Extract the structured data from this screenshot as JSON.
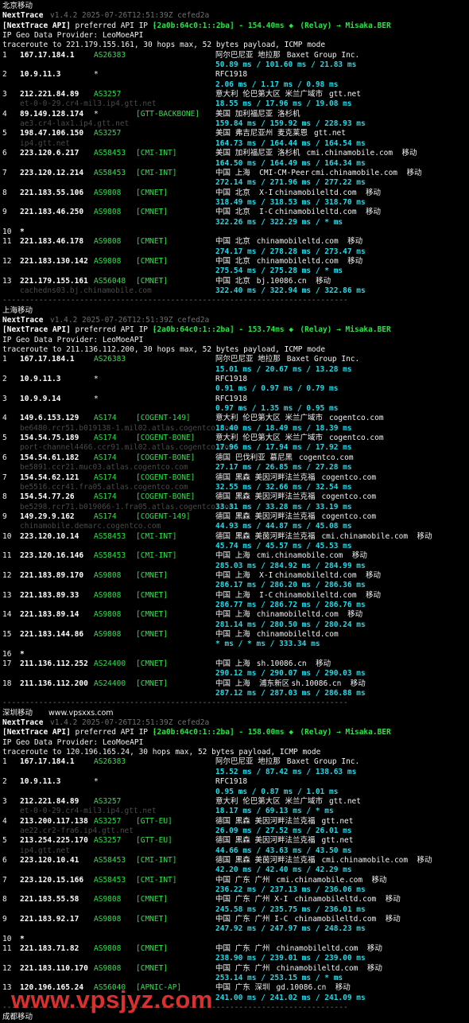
{
  "watermark": "www.vpsjyz.com",
  "sections": [
    {
      "title": "北京移动",
      "header": {
        "app": "NextTrace",
        "version": "v1.4.2 2025-07-26T12:51:39Z cefed2a",
        "api_prefix": "[NextTrace API]",
        "api_text": " preferred API IP - ",
        "api_ip": "[2a0b:64c0:1::2ba]",
        "api_ms": " - 154.40ms - ",
        "relay": "(Relay) → Misaka.BER",
        "geo": "IP Geo Data Provider: LeoMoeAPI",
        "traceroute": "traceroute to 221.179.155.161, 30 hops max, 52 bytes payload, ICMP mode"
      },
      "hops": [
        {
          "n": "1",
          "ip": "167.17.184.1",
          "asn": "AS26383",
          "tag": "",
          "geo": "阿尔巴尼亚 地拉那",
          "org": "Baxet Group Inc.",
          "host": "",
          "rtt": "50.89 ms / 101.60 ms / 21.83 ms"
        },
        {
          "n": "2",
          "ip": "10.9.11.3",
          "asn": "*",
          "tag": "",
          "geo": "RFC1918",
          "org": "",
          "host": "",
          "rtt": "2.06 ms / 1.17 ms / 0.98 ms"
        },
        {
          "n": "3",
          "ip": "212.221.84.89",
          "asn": "AS3257",
          "tag": "",
          "geo": "意大利 伦巴第大区 米兰广域市",
          "org": "gtt.net",
          "host": "et-0-0-29.cr4-mil3.ip4.gtt.net",
          "rtt": "18.55 ms / 17.96 ms / 19.08 ms"
        },
        {
          "n": "4",
          "ip": "89.149.128.174",
          "asn": "*",
          "tag": "[GTT-BACKBONE]",
          "geo": "美国 加利福尼亚 洛杉机",
          "org": "",
          "host": "ae3.cr4-lax1.ip4.gtt.net",
          "rtt": "159.84 ms / 159.92 ms / 228.93 ms"
        },
        {
          "n": "5",
          "ip": "198.47.106.150",
          "asn": "AS3257",
          "tag": "",
          "geo": "美国 弗吉尼亚州 麦克莱恩",
          "org": "gtt.net",
          "host": "ip4.gtt.net",
          "rtt": "164.73 ms / 164.44 ms / 164.54 ms"
        },
        {
          "n": "6",
          "ip": "223.120.6.217",
          "asn": "AS58453",
          "tag": "[CMI-INT]",
          "geo": "美国 加利福尼亚 洛杉机",
          "org": "cmi.chinamobile.com  移动",
          "host": "",
          "rtt": "164.50 ms / 164.49 ms / 164.34 ms"
        },
        {
          "n": "7",
          "ip": "223.120.12.214",
          "asn": "AS58453",
          "tag": "[CMI-INT]",
          "geo": "中国 上海  CMI-CM-Peer",
          "org": "cmi.chinamobile.com  移动",
          "host": "",
          "rtt": "272.14 ms / 271.96 ms / 277.22 ms"
        },
        {
          "n": "8",
          "ip": "221.183.55.106",
          "asn": "AS9808",
          "tag": "[CMNET]",
          "geo": "中国 北京  X-I",
          "org": "chinamobileltd.com  移动",
          "host": "",
          "rtt": "318.49 ms / 318.53 ms / 318.70 ms"
        },
        {
          "n": "9",
          "ip": "221.183.46.250",
          "asn": "AS9808",
          "tag": "[CMNET]",
          "geo": "中国 北京  I-C",
          "org": "chinamobileltd.com  移动",
          "host": "",
          "rtt": "322.26 ms / 322.29 ms / * ms"
        },
        {
          "n": "10",
          "ip": "*",
          "asn": "",
          "tag": "",
          "geo": "",
          "org": "",
          "host": "",
          "rtt": ""
        },
        {
          "n": "11",
          "ip": "221.183.46.178",
          "asn": "AS9808",
          "tag": "[CMNET]",
          "geo": "中国 北京",
          "org": "chinamobileltd.com  移动",
          "host": "",
          "rtt": "274.17 ms / 278.28 ms / 273.47 ms"
        },
        {
          "n": "12",
          "ip": "221.183.130.142",
          "asn": "AS9808",
          "tag": "[CMNET]",
          "geo": "中国 北京",
          "org": "chinamobileltd.com  移动",
          "host": "",
          "rtt": "275.54 ms / 275.28 ms / * ms"
        },
        {
          "n": "13",
          "ip": "221.179.155.161",
          "asn": "AS56048",
          "tag": "[CMNET]",
          "geo": "中国 北京",
          "org": "bj.10086.cn  移动",
          "host": "cachedns03.bj.chinamobile.com",
          "rtt": "322.40 ms / 322.94 ms / 322.86 ms"
        }
      ]
    },
    {
      "title": "上海移动",
      "header": {
        "app": "NextTrace",
        "version": "v1.4.2 2025-07-26T12:51:39Z cefed2a",
        "api_prefix": "[NextTrace API]",
        "api_text": " preferred API IP - ",
        "api_ip": "[2a0b:64c0:1::2ba]",
        "api_ms": " - 153.74ms - ",
        "relay": "(Relay) → Misaka.BER",
        "geo": "IP Geo Data Provider: LeoMoeAPI",
        "traceroute": "traceroute to 211.136.112.200, 30 hops max, 52 bytes payload, ICMP mode"
      },
      "hops": [
        {
          "n": "1",
          "ip": "167.17.184.1",
          "asn": "AS26383",
          "tag": "",
          "geo": "阿尔巴尼亚 地拉那",
          "org": "Baxet Group Inc.",
          "host": "",
          "rtt": "15.01 ms / 20.67 ms / 13.28 ms"
        },
        {
          "n": "2",
          "ip": "10.9.11.3",
          "asn": "*",
          "tag": "",
          "geo": "RFC1918",
          "org": "",
          "host": "",
          "rtt": "0.91 ms / 0.97 ms / 0.79 ms"
        },
        {
          "n": "3",
          "ip": "10.9.9.14",
          "asn": "*",
          "tag": "",
          "geo": "RFC1918",
          "org": "",
          "host": "",
          "rtt": "0.97 ms / 1.35 ms / 0.95 ms"
        },
        {
          "n": "4",
          "ip": "149.6.153.129",
          "asn": "AS174",
          "tag": "[COGENT-149]",
          "geo": "意大利 伦巴第大区 米兰广域市",
          "org": "cogentco.com",
          "host": "be6480.rcr51.b019138-1.mil02.atlas.cogentco.com",
          "rtt": "18.40 ms / 18.49 ms / 18.39 ms"
        },
        {
          "n": "5",
          "ip": "154.54.75.189",
          "asn": "AS174",
          "tag": "[COGENT-BONE]",
          "geo": "意大利 伦巴第大区 米兰广域市",
          "org": "cogentco.com",
          "host": "port-channel4466.ccr91.mil02.atlas.cogentco.com",
          "rtt": "17.96 ms / 17.94 ms / 17.92 ms"
        },
        {
          "n": "6",
          "ip": "154.54.61.182",
          "asn": "AS174",
          "tag": "[COGENT-BONE]",
          "geo": "德国 巴伐利亚 慕尼黑",
          "org": "cogentco.com",
          "host": "be5891.ccr21.muc03.atlas.cogentco.com",
          "rtt": "27.17 ms / 26.85 ms / 27.28 ms"
        },
        {
          "n": "7",
          "ip": "154.54.62.121",
          "asn": "AS174",
          "tag": "[COGENT-BONE]",
          "geo": "德国 黑森 美因河畔法兰克福",
          "org": "cogentco.com",
          "host": "be5516.ccr41.fra05.atlas.cogentco.com",
          "rtt": "32.55 ms / 32.66 ms / 32.54 ms"
        },
        {
          "n": "8",
          "ip": "154.54.77.26",
          "asn": "AS174",
          "tag": "[COGENT-BONE]",
          "geo": "德国 黑森 美因河畔法兰克福",
          "org": "cogentco.com",
          "host": "be5298.rcr71.b019066-1.fra05.atlas.cogentco.com",
          "rtt": "33.31 ms / 33.28 ms / 33.19 ms"
        },
        {
          "n": "9",
          "ip": "149.29.9.162",
          "asn": "AS174",
          "tag": "[COGENT-149]",
          "geo": "德国 黑森 美因河畔法兰克福",
          "org": "cogentco.com",
          "host": "chinamobile.demarc.cogentco.com",
          "rtt": "44.93 ms / 44.87 ms / 45.08 ms"
        },
        {
          "n": "10",
          "ip": "223.120.10.14",
          "asn": "AS58453",
          "tag": "[CMI-INT]",
          "geo": "德国 黑森 美茵河畔法兰克福",
          "org": "cmi.chinamobile.com  移动",
          "host": "",
          "rtt": "45.74 ms / 45.57 ms / 45.53 ms"
        },
        {
          "n": "11",
          "ip": "223.120.16.146",
          "asn": "AS58453",
          "tag": "[CMI-INT]",
          "geo": "中国 上海",
          "org": "cmi.chinamobile.com  移动",
          "host": "",
          "rtt": "285.03 ms / 284.92 ms / 284.99 ms"
        },
        {
          "n": "12",
          "ip": "221.183.89.170",
          "asn": "AS9808",
          "tag": "[CMNET]",
          "geo": "中国 上海  X-I",
          "org": "chinamobileltd.com  移动",
          "host": "",
          "rtt": "286.17 ms / 286.20 ms / 286.36 ms"
        },
        {
          "n": "13",
          "ip": "221.183.89.33",
          "asn": "AS9808",
          "tag": "[CMNET]",
          "geo": "中国 上海  I-C",
          "org": "chinamobileltd.com  移动",
          "host": "",
          "rtt": "286.77 ms / 286.72 ms / 286.76 ms"
        },
        {
          "n": "14",
          "ip": "221.183.89.14",
          "asn": "AS9808",
          "tag": "[CMNET]",
          "geo": "中国 上海",
          "org": "chinamobileltd.com  移动",
          "host": "",
          "rtt": "281.14 ms / 280.50 ms / 280.24 ms"
        },
        {
          "n": "15",
          "ip": "221.183.144.86",
          "asn": "AS9808",
          "tag": "[CMNET]",
          "geo": "中国 上海",
          "org": "chinamobileltd.com",
          "host": "",
          "rtt": "* ms / * ms / 333.34 ms"
        },
        {
          "n": "16",
          "ip": "*",
          "asn": "",
          "tag": "",
          "geo": "",
          "org": "",
          "host": "",
          "rtt": ""
        },
        {
          "n": "17",
          "ip": "211.136.112.252",
          "asn": "AS24400",
          "tag": "[CMNET]",
          "geo": "中国 上海",
          "org": "sh.10086.cn  移动",
          "host": "",
          "rtt": "290.12 ms / 290.07 ms / 290.03 ms"
        },
        {
          "n": "18",
          "ip": "211.136.112.200",
          "asn": "AS24400",
          "tag": "[CMNET]",
          "geo": "中国 上海  浦东新区",
          "org": "sh.10086.cn  移动",
          "host": "",
          "rtt": "287.12 ms / 287.03 ms / 286.88 ms"
        }
      ]
    },
    {
      "title": "深圳移动",
      "title_extra": "www.vpsxxs.com",
      "header": {
        "app": "NextTrace",
        "version": "v1.4.2 2025-07-26T12:51:39Z cefed2a",
        "api_prefix": "[NextTrace API]",
        "api_text": " preferred API IP - ",
        "api_ip": "[2a0b:64c0:1::2ba]",
        "api_ms": " - 158.00ms - ",
        "relay": "(Relay) → Misaka.BER",
        "geo": "IP Geo Data Provider: LeoMoeAPI",
        "traceroute": "traceroute to 120.196.165.24, 30 hops max, 52 bytes payload, ICMP mode"
      },
      "hops": [
        {
          "n": "1",
          "ip": "167.17.184.1",
          "asn": "AS26383",
          "tag": "",
          "geo": "阿尔巴尼亚 地拉那",
          "org": "Baxet Group Inc.",
          "host": "",
          "rtt": "15.52 ms / 87.42 ms / 138.63 ms"
        },
        {
          "n": "2",
          "ip": "10.9.11.3",
          "asn": "*",
          "tag": "",
          "geo": "RFC1918",
          "org": "",
          "host": "",
          "rtt": "0.95 ms / 0.87 ms / 1.01 ms"
        },
        {
          "n": "3",
          "ip": "212.221.84.89",
          "asn": "AS3257",
          "tag": "",
          "geo": "意大利 伦巴第大区 米兰广域市",
          "org": "gtt.net",
          "host": "et-0-0-29.cr4-mil3.ip4.gtt.net",
          "rtt": "18.17 ms / 69.13 ms / * ms"
        },
        {
          "n": "4",
          "ip": "213.200.117.138",
          "asn": "AS3257",
          "tag": "[GTT-EU]",
          "geo": "德国 黑森 美因河畔法兰克福",
          "org": "gtt.net",
          "host": "ae22.cr2-fra6.ip4.gtt.net",
          "rtt": "26.09 ms / 27.52 ms / 26.01 ms"
        },
        {
          "n": "5",
          "ip": "213.254.225.170",
          "asn": "AS3257",
          "tag": "[GTT-EU]",
          "geo": "德国 黑森 美因河畔法兰克福",
          "org": "gtt.net",
          "host": "ip4.gtt.net",
          "rtt": "44.66 ms / 43.63 ms / 43.50 ms"
        },
        {
          "n": "6",
          "ip": "223.120.10.41",
          "asn": "AS58453",
          "tag": "[CMI-INT]",
          "geo": "德国 黑森 美茵河畔法兰克福",
          "org": "cmi.chinamobile.com  移动",
          "host": "",
          "rtt": "42.20 ms / 42.40 ms / 42.29 ms"
        },
        {
          "n": "7",
          "ip": "223.120.15.166",
          "asn": "AS58453",
          "tag": "[CMI-INT]",
          "geo": "中国 广东 广州",
          "org": "cmi.chinamobile.com  移动",
          "host": "",
          "rtt": "236.22 ms / 237.13 ms / 236.06 ms"
        },
        {
          "n": "8",
          "ip": "221.183.55.58",
          "asn": "AS9808",
          "tag": "[CMNET]",
          "geo": "中国 广东 广州 X-I",
          "org": "chinamobileltd.com  移动",
          "host": "",
          "rtt": "245.58 ms / 235.75 ms / 236.01 ms"
        },
        {
          "n": "9",
          "ip": "221.183.92.17",
          "asn": "AS9808",
          "tag": "[CMNET]",
          "geo": "中国 广东 广州 I-C",
          "org": "chinamobileltd.com  移动",
          "host": "",
          "rtt": "247.92 ms / 247.97 ms / 248.23 ms"
        },
        {
          "n": "10",
          "ip": "*",
          "asn": "",
          "tag": "",
          "geo": "",
          "org": "",
          "host": "",
          "rtt": ""
        },
        {
          "n": "11",
          "ip": "221.183.71.82",
          "asn": "AS9808",
          "tag": "[CMNET]",
          "geo": "中国 广东 广州",
          "org": "chinamobileltd.com  移动",
          "host": "",
          "rtt": "238.90 ms / 239.01 ms / 239.00 ms"
        },
        {
          "n": "12",
          "ip": "221.183.110.170",
          "asn": "AS9808",
          "tag": "[CMNET]",
          "geo": "中国 广东 广州",
          "org": "chinamobileltd.com  移动",
          "host": "",
          "rtt": "253.14 ms / 253.15 ms / * ms"
        },
        {
          "n": "13",
          "ip": "120.196.165.24",
          "asn": "AS56040",
          "tag": "[APNIC-AP]",
          "geo": "中国 广东 深圳",
          "org": "gd.10086.cn  移动",
          "host": "",
          "rtt": "241.00 ms / 241.02 ms / 241.09 ms"
        }
      ]
    }
  ],
  "separator": "----------------------------------------------------------------------------",
  "footer_title": "成都移动"
}
